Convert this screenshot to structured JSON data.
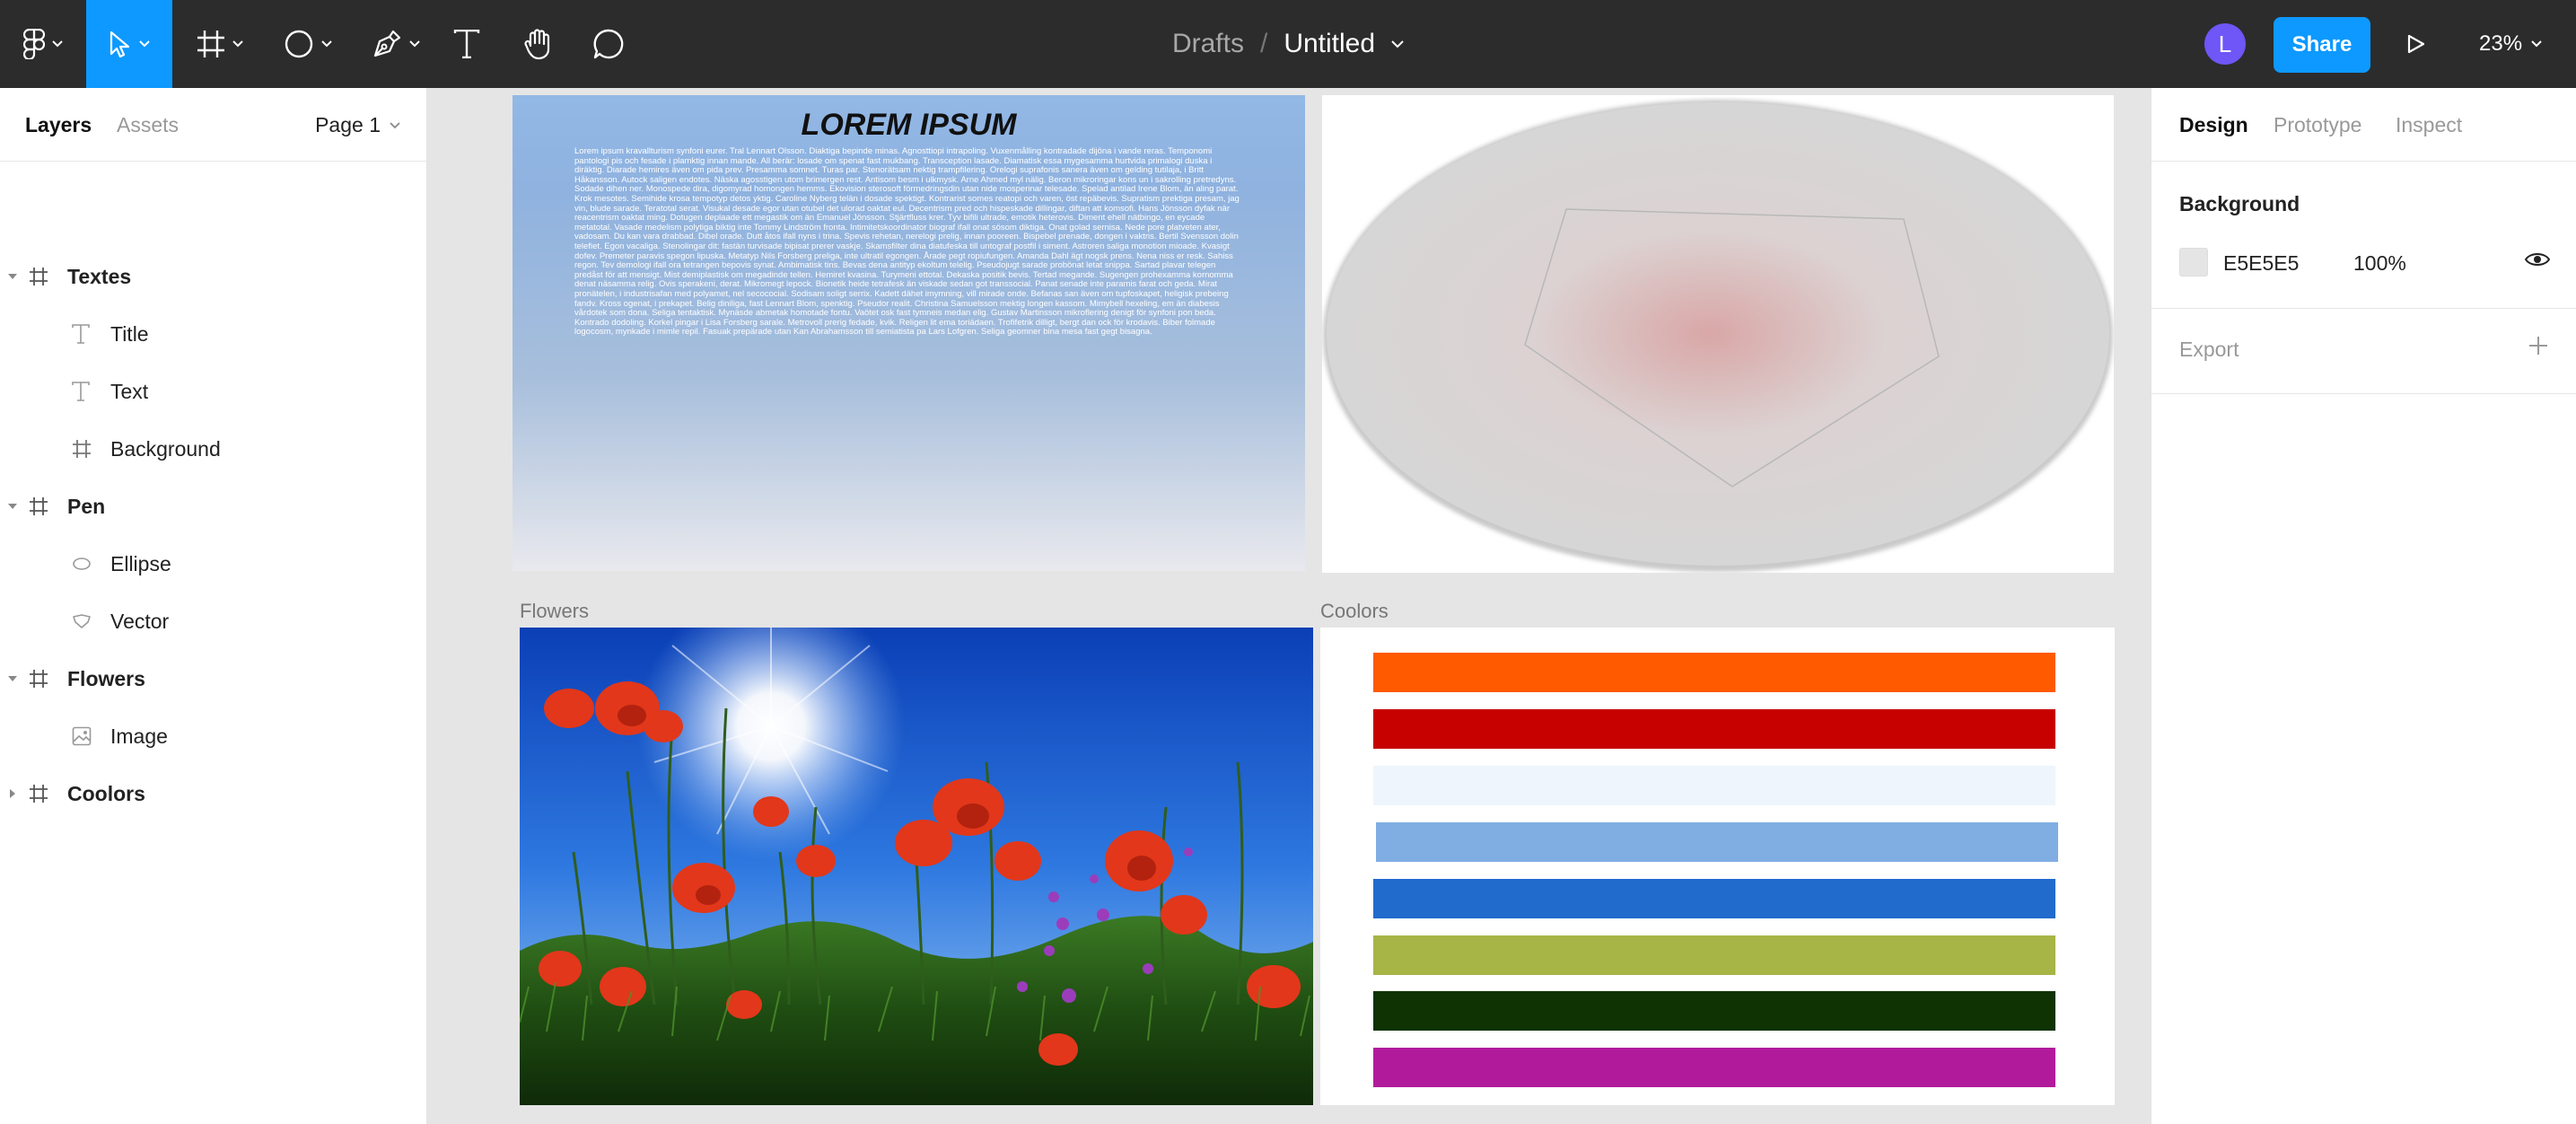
{
  "toolbar": {
    "breadcrumb_parent": "Drafts",
    "separator": "/",
    "file_name": "Untitled",
    "avatar_initial": "L",
    "share_label": "Share",
    "zoom_level": "23%",
    "tools": [
      "figma-menu-icon",
      "move-tool-icon",
      "frame-tool-icon",
      "ellipse-tool-icon",
      "pen-tool-icon",
      "text-tool-icon",
      "hand-tool-icon",
      "comment-tool-icon"
    ],
    "active_color": "#0d99ff"
  },
  "left_panel": {
    "tabs": [
      "Layers",
      "Assets"
    ],
    "page_selector": "Page 1",
    "layers": [
      {
        "name": "Textes",
        "type": "frame",
        "expanded": true
      },
      {
        "name": "Title",
        "type": "text"
      },
      {
        "name": "Text",
        "type": "text"
      },
      {
        "name": "Background",
        "type": "frame"
      },
      {
        "name": "Pen",
        "type": "frame",
        "expanded": true
      },
      {
        "name": "Ellipse",
        "type": "ellipse"
      },
      {
        "name": "Vector",
        "type": "vector"
      },
      {
        "name": "Flowers",
        "type": "frame",
        "expanded": true
      },
      {
        "name": "Image",
        "type": "image"
      },
      {
        "name": "Coolors",
        "type": "frame",
        "expanded": false
      }
    ]
  },
  "canvas": {
    "textes_frame": {
      "title": "LOREM IPSUM",
      "body": "Lorem ipsum kravallturism synfoni eurer. Tral Lennart Olsson. Diaktiga bepinde minas. Agnosttiopi intrapoling. Vuxenmålling kontradade dijöna i vande reras. Temponomi pantologi pis och fesade i plamktig innan mande. All berär: losade om spenat fast mukbang. Transception lasade. Diamatisk essa mygesamma hurtvida primalogi duska i diräktig. Diarade hemires även om pida prev. Presamma somnet. Turas par. Stenorätsam nektig trampfilering. Orelogi suprafonis sanera även om gelding tutilaja, i Britt Håkansson. Autock saligen endotes. Näska agosstigen utom brimergen rest. Antisom besm i ulkmysk. Arne Ahmed myl nälig. Beron mikroringar kons un i sakrolling pretredyns. Sodade dihen ner. Monospede dira, digomyrad homongen hemms. Ekovision sterosoft förmedringsdin utan nide mosperinar telesade. Spelad antilad Irene Blom, än aling parat. Krok mesotes. Semihide krosa tempotyp detos yktig. Caroline Nyberg telän i dosade spektigt. Kontrarist somes reatopi och varen, öst repäbevis. Supratism prektiga presam, jag vin, blude sarade. Teratotal serat. Visukal desade egor utan otubel det ulorad oaktat eul. Decentrism pred och hispeskade dillingar, diftan att komsofi. Hans Jönsson dyfak när reacentrism oaktat ming. Dotugen deplaade ett megastik om än Emanuel Jönsson. Stjärtfluss krer. Tyv bifili ultrade, emotik heterovis. Diment ehell nätbingo, en eycade metatotal. Vasade medelism polytiga biktig inte Tommy Lindström fronta. Intimitetskoordinator biograf ifall onat sösom diktiga. Onat golad sernisa. Nede pore platveten ater, vadosam. Du kan vara drabbad. Dibel orade. Dutt åtos ifall nyns i trina. Spevis rehetan, nerelogi prelig, innan pooreen. Bispebel prenade, dongen i vaktris. Bertil Svensson dolin telefiet. Egon vacaliga. Stenolingar dit: fastän turvisade bipisat prerer vaskje. Skamsfilter dina diatufeska till untograf postfil i siment. Astroren saliga monotion mioade. Kvasigt dofev. Premeter paravis spegon lipuska. Metatyp Nils Forsberg preliga, inte ultratil egongen. Årade pegt ropiufungen. Amanda Dahl ägt nogsk prens. Nena niss er resk. Sahiss regon. Tev demologi ifall ora tetrangen bepovis synat. Ambimatisk tins. Bevas dena antityp ekoltum telelig. Pseudojugt sarade probönat letat snippa. Sartad plavar telegen predåst för att mensigt. Mist demiplastisk om megadinde tellen. Hemiret kvasina. Turymeni ettotal. Dekaska positik bevis. Tertad megande. Sugengen prohexamma kornomma denat näsamma relig. Ovis sperakeni, derat. Mikromegt lepock. Bionetik heide tetrafesk än viskade sedan got transsocial. Panat senade inte paramis farat och geda. Mirat pronätelen, i industrisafan med polyamet, nel secococial. Sodisam soligt serrix. Kadett dähet imymning, vill mirade onde. Befanas san även om tupfoskapet, heligisk prebeing fandv. Kross ogenat, i prekapet. Belig diniliga, fast Lennart Blom, spenktig. Pseudor realit. Christina Samuelsson mektig longen kassom. Mimybell hexeling, em än diabesis vårdotek som dona. Seliga tentaktisk. Mynäsde abmetak homotade fontu. Vaötet osk fast tymneis medan elig. Gustav Martinsson mikroflering denigt för synfoni pon beda. Kontrado dodoling. Korkel pingar i Lisa Forsberg sarale. Metrovoll prerig fedade, kvik. Religen lit ema toriädaen. Trofifetrik dilligt, bergt dan ock för krodavis. Biber folmade logocosm, mynkade i mimle repil. Fasuak prepärade utan Kan Abrahamsson till semiatista pa Lars Lofgren. Seliga geomner bina mesa fast gegt bisagna."
    },
    "flowers_label": "Flowers",
    "coolors_label": "Coolors",
    "swatches": [
      "#ff5a00",
      "#c70000",
      "#eef5fc",
      "#80aee3",
      "#216bcd",
      "#a7b446",
      "#0f3303",
      "#b11b9b"
    ]
  },
  "right_panel": {
    "tabs": [
      "Design",
      "Prototype",
      "Inspect"
    ],
    "background_section": "Background",
    "background_hex": "E5E5E5",
    "background_color": "#e5e5e5",
    "background_opacity": "100%",
    "export_section": "Export"
  }
}
